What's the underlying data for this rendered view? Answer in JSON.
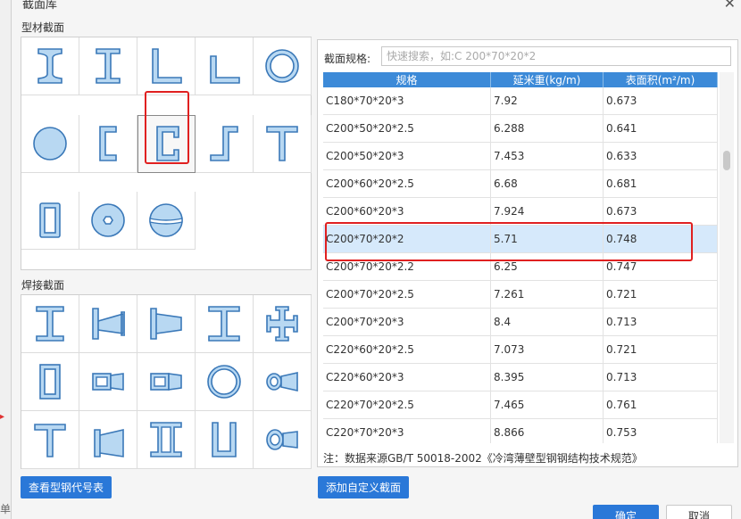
{
  "dialog": {
    "title": "截面库"
  },
  "edge": {
    "label": "单"
  },
  "profile_section": {
    "label": "型材截面",
    "icons": [
      "i-beam-icon",
      "h-beam-icon",
      "angle-icon",
      "unequal-angle-icon",
      "pipe-icon",
      "round-bar-icon",
      "channel-icon",
      "c-section-icon",
      "z-section-icon",
      "t-section-icon",
      "rect-tube-icon",
      "hex-hole-circle-icon",
      "split-circle-icon"
    ]
  },
  "welded_section": {
    "label": "焊接截面",
    "icons": [
      "welded-i-icon",
      "tapered-i-icon",
      "tapered-i2-icon",
      "welded-h-icon",
      "cross-section-icon",
      "welded-box-icon",
      "tapered-box-icon",
      "tapered-box2-icon",
      "welded-pipe-icon",
      "tapered-pipe-icon",
      "welded-t-icon",
      "tapered-t-icon",
      "double-i-icon",
      "u-section-icon",
      "tapered-oval-icon"
    ]
  },
  "buttons": {
    "view_codes": "查看型钢代号表",
    "add_custom": "添加自定义截面",
    "ok": "确定",
    "cancel": "取消"
  },
  "search": {
    "label": "截面规格:",
    "placeholder": "快速搜索，如:C 200*70*20*2"
  },
  "table": {
    "headers": [
      "规格",
      "延米重(kg/m)",
      "表面积(m²/m)"
    ],
    "rows": [
      [
        "C180*70*20*3",
        "7.92",
        "0.673"
      ],
      [
        "C200*50*20*2.5",
        "6.288",
        "0.641"
      ],
      [
        "C200*50*20*3",
        "7.453",
        "0.633"
      ],
      [
        "C200*60*20*2.5",
        "6.68",
        "0.681"
      ],
      [
        "C200*60*20*3",
        "7.924",
        "0.673"
      ],
      [
        "C200*70*20*2",
        "5.71",
        "0.748"
      ],
      [
        "C200*70*20*2.2",
        "6.25",
        "0.747"
      ],
      [
        "C200*70*20*2.5",
        "7.261",
        "0.721"
      ],
      [
        "C200*70*20*3",
        "8.4",
        "0.713"
      ],
      [
        "C220*60*20*2.5",
        "7.073",
        "0.721"
      ],
      [
        "C220*60*20*3",
        "8.395",
        "0.713"
      ],
      [
        "C220*70*20*2.5",
        "7.465",
        "0.761"
      ],
      [
        "C220*70*20*3",
        "8.866",
        "0.753"
      ]
    ]
  },
  "note": "注：数据来源GB/T 50018-2002《冷湾薄壁型钢钢结构技术规范》"
}
